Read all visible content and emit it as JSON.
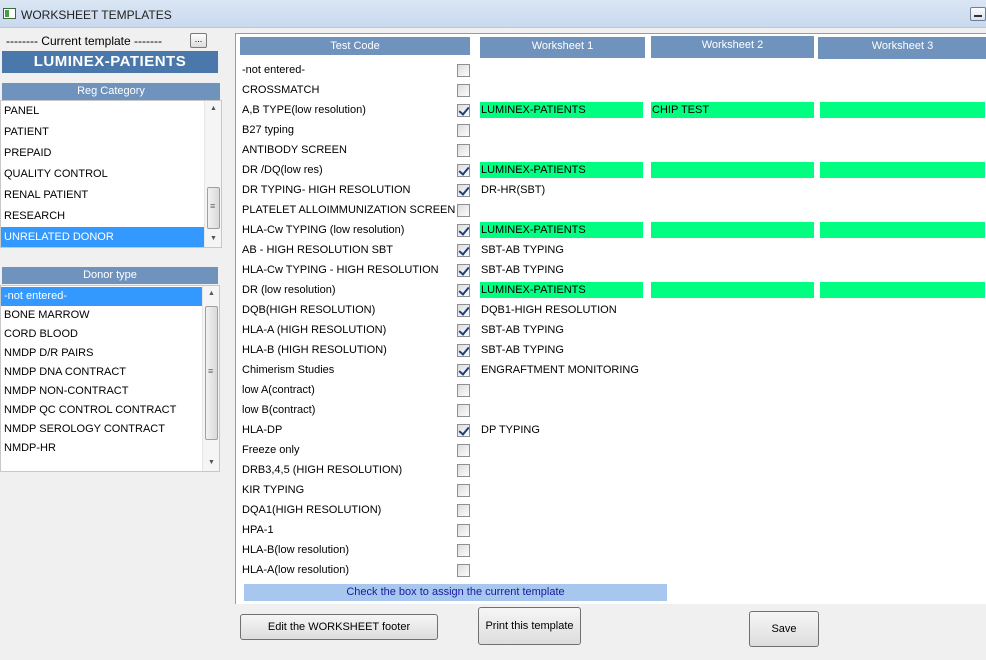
{
  "window": {
    "title": "WORKSHEET TEMPLATES"
  },
  "current_template": {
    "label": "-------- Current template -------",
    "browse_label": "...",
    "name": "LUMINEX-PATIENTS"
  },
  "reg_category": {
    "header": "Reg Category",
    "items": [
      "PANEL",
      "PATIENT",
      "PREPAID",
      "QUALITY CONTROL",
      "RENAL PATIENT",
      "RESEARCH",
      "UNRELATED DONOR"
    ],
    "selected": "UNRELATED DONOR"
  },
  "donor_type": {
    "header": "Donor type",
    "items": [
      "-not entered-",
      "BONE MARROW",
      "CORD BLOOD",
      "NMDP D/R PAIRS",
      "NMDP DNA CONTRACT",
      "NMDP NON-CONTRACT",
      "NMDP QC CONTROL CONTRACT",
      "NMDP SEROLOGY CONTRACT",
      "NMDP-HR"
    ],
    "selected": "-not entered-"
  },
  "grid": {
    "headers": {
      "test_code": "Test Code",
      "ws1": "Worksheet 1",
      "ws2": "Worksheet 2",
      "ws3": "Worksheet 3"
    },
    "rows": [
      {
        "code": "-not entered-",
        "checked": false,
        "ws": [
          "",
          "",
          ""
        ],
        "green": false
      },
      {
        "code": "CROSSMATCH",
        "checked": false,
        "ws": [
          "",
          "",
          ""
        ],
        "green": false
      },
      {
        "code": "A,B TYPE(low resolution)",
        "checked": true,
        "ws": [
          "LUMINEX-PATIENTS",
          "CHIP TEST",
          ""
        ],
        "green": true
      },
      {
        "code": "B27 typing",
        "checked": false,
        "ws": [
          "",
          "",
          ""
        ],
        "green": false
      },
      {
        "code": "ANTIBODY SCREEN",
        "checked": false,
        "ws": [
          "",
          "",
          ""
        ],
        "green": false
      },
      {
        "code": "DR /DQ(low res)",
        "checked": true,
        "ws": [
          "LUMINEX-PATIENTS",
          "",
          ""
        ],
        "green": true
      },
      {
        "code": "DR TYPING- HIGH RESOLUTION",
        "checked": true,
        "ws": [
          "DR-HR(SBT)",
          "",
          ""
        ],
        "green": false
      },
      {
        "code": "PLATELET ALLOIMMUNIZATION SCREEN",
        "checked": false,
        "ws": [
          "",
          "",
          ""
        ],
        "green": false
      },
      {
        "code": "HLA-Cw TYPING (low resolution)",
        "checked": true,
        "ws": [
          "LUMINEX-PATIENTS",
          "",
          ""
        ],
        "green": true
      },
      {
        "code": "AB - HIGH RESOLUTION SBT",
        "checked": true,
        "ws": [
          "SBT-AB TYPING",
          "",
          ""
        ],
        "green": false
      },
      {
        "code": "HLA-Cw TYPING - HIGH RESOLUTION",
        "checked": true,
        "ws": [
          "SBT-AB TYPING",
          "",
          ""
        ],
        "green": false
      },
      {
        "code": "DR (low resolution)",
        "checked": true,
        "ws": [
          "LUMINEX-PATIENTS",
          "",
          ""
        ],
        "green": true
      },
      {
        "code": "DQB(HIGH RESOLUTION)",
        "checked": true,
        "ws": [
          "DQB1-HIGH RESOLUTION",
          "",
          ""
        ],
        "green": false
      },
      {
        "code": "HLA-A (HIGH RESOLUTION)",
        "checked": true,
        "ws": [
          "SBT-AB TYPING",
          "",
          ""
        ],
        "green": false
      },
      {
        "code": "HLA-B (HIGH RESOLUTION)",
        "checked": true,
        "ws": [
          "SBT-AB TYPING",
          "",
          ""
        ],
        "green": false
      },
      {
        "code": "Chimerism Studies",
        "checked": true,
        "ws": [
          "ENGRAFTMENT MONITORING",
          "",
          ""
        ],
        "green": false
      },
      {
        "code": "low A(contract)",
        "checked": false,
        "ws": [
          "",
          "",
          ""
        ],
        "green": false
      },
      {
        "code": "low B(contract)",
        "checked": false,
        "ws": [
          "",
          "",
          ""
        ],
        "green": false
      },
      {
        "code": "HLA-DP",
        "checked": true,
        "ws": [
          "DP TYPING",
          "",
          ""
        ],
        "green": false
      },
      {
        "code": "Freeze only",
        "checked": false,
        "ws": [
          "",
          "",
          ""
        ],
        "green": false
      },
      {
        "code": "DRB3,4,5 (HIGH RESOLUTION)",
        "checked": false,
        "ws": [
          "",
          "",
          ""
        ],
        "green": false
      },
      {
        "code": "KIR TYPING",
        "checked": false,
        "ws": [
          "",
          "",
          ""
        ],
        "green": false
      },
      {
        "code": "DQA1(HIGH RESOLUTION)",
        "checked": false,
        "ws": [
          "",
          "",
          ""
        ],
        "green": false
      },
      {
        "code": "HPA-1",
        "checked": false,
        "ws": [
          "",
          "",
          ""
        ],
        "green": false
      },
      {
        "code": "HLA-B(low resolution)",
        "checked": false,
        "ws": [
          "",
          "",
          ""
        ],
        "green": false
      },
      {
        "code": "HLA-A(low resolution)",
        "checked": false,
        "ws": [
          "",
          "",
          ""
        ],
        "green": false
      }
    ],
    "hint": "Check the box to assign the current template"
  },
  "buttons": {
    "edit_footer": "Edit the WORKSHEET footer",
    "print": "Print this template",
    "save": "Save"
  },
  "colors": {
    "header_blue": "#6f93bd",
    "template_blue": "#4b78ab",
    "assigned_green": "#00ff80",
    "selection_blue": "#3399ff"
  }
}
